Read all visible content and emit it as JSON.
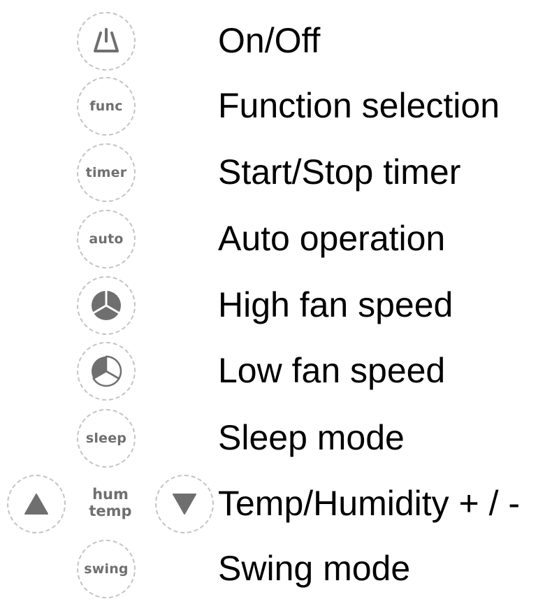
{
  "buttons": [
    {
      "name": "power",
      "icon": "power-icon",
      "label": "On/Off"
    },
    {
      "name": "func",
      "button_text": "func",
      "label": "Function selection"
    },
    {
      "name": "timer",
      "button_text": "timer",
      "label": "Start/Stop timer"
    },
    {
      "name": "auto",
      "button_text": "auto",
      "label": "Auto operation"
    },
    {
      "name": "high-fan",
      "icon": "high-fan-speed-icon",
      "label": "High fan speed"
    },
    {
      "name": "low-fan",
      "icon": "low-fan-speed-icon",
      "label": "Low fan speed"
    },
    {
      "name": "sleep",
      "button_text": "sleep",
      "label": "Sleep mode"
    },
    {
      "name": "temp-hum",
      "button_text_top": "hum",
      "button_text_bottom": "temp",
      "up_icon": "triangle-up-icon",
      "down_icon": "triangle-down-icon",
      "label": "Temp/Humidity + / -"
    },
    {
      "name": "swing",
      "button_text": "swing",
      "label": "Swing mode"
    }
  ],
  "colors": {
    "button_text": "#6f6f6f",
    "button_border": "#c4c4c4",
    "label_text": "#000000"
  }
}
